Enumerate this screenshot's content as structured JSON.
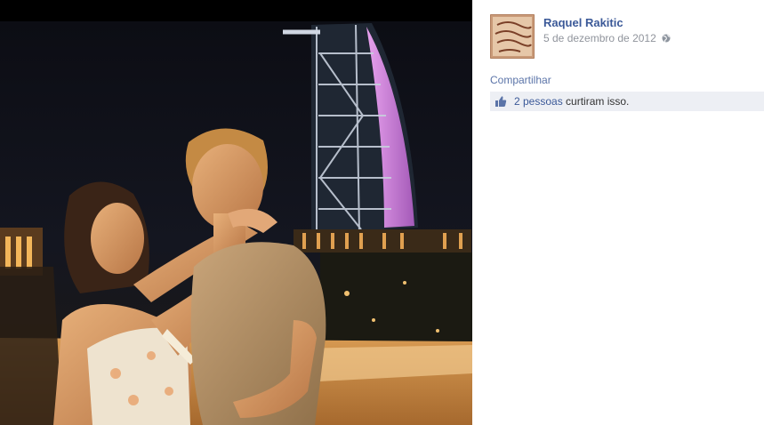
{
  "post": {
    "author_name": "Raquel Rakitic",
    "date": "5 de dezembro de 2012",
    "privacy_icon": "globe-icon",
    "share_label": "Compartilhar",
    "likes": {
      "icon": "thumbs-up-icon",
      "link_text": "2 pessoas",
      "suffix_text": "curtiram isso."
    }
  },
  "colors": {
    "link": "#3b5998",
    "likes_bar": "#edeff4",
    "meta_text": "#90949c",
    "tower_glow": "#d97fe0"
  }
}
